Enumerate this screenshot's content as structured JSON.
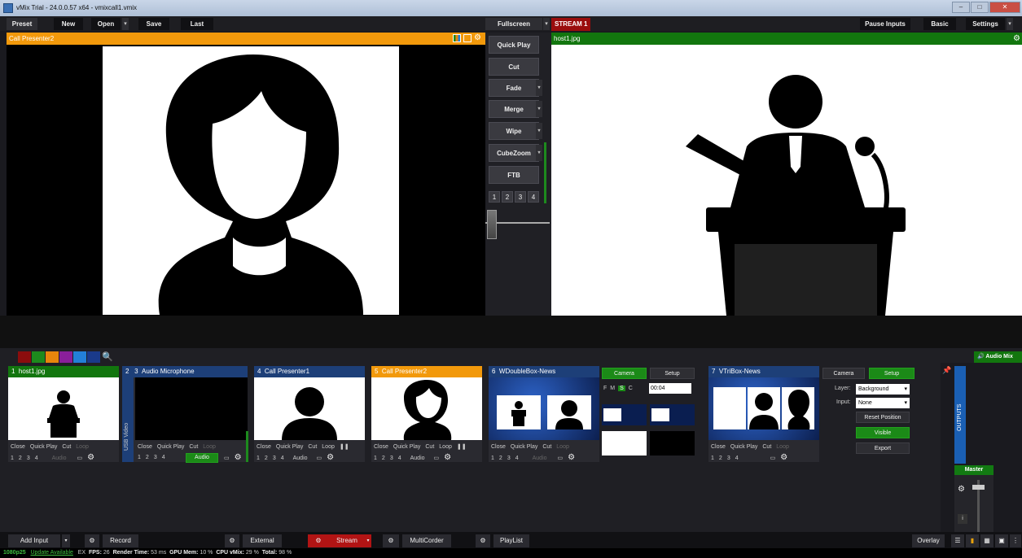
{
  "window": {
    "title": "vMix Trial - 24.0.0.57 x64 - vmixcall1.vmix"
  },
  "topbar": {
    "preset": "Preset",
    "new": "New",
    "open": "Open",
    "save": "Save",
    "last": "Last",
    "fullscreen": "Fullscreen",
    "stream_tab": "STREAM 1",
    "pause_inputs": "Pause Inputs",
    "basic": "Basic",
    "settings": "Settings"
  },
  "preview": {
    "title": "Call Presenter2"
  },
  "program": {
    "title": "host1.jpg"
  },
  "transitions": {
    "quick_play": "Quick Play",
    "cut": "Cut",
    "fade": "Fade",
    "merge": "Merge",
    "wipe": "Wipe",
    "cubezoom": "CubeZoom",
    "ftb": "FTB",
    "nums": [
      "1",
      "2",
      "3",
      "4"
    ]
  },
  "colors": {
    "chips": [
      "#8b0d0d",
      "#1d8a1d",
      "#e8860c",
      "#8a1f9a",
      "#2380d8",
      "#1a3a8a"
    ]
  },
  "inputs": [
    {
      "num": "1",
      "name": "host1.jpg",
      "hdr_color": "#12760e"
    },
    {
      "num": "2",
      "name": "",
      "hdr_color": "#1d3f78"
    },
    {
      "num": "3",
      "name": "Audio Microphone",
      "hdr_color": "#1d3f78"
    },
    {
      "num": "4",
      "name": "Call Presenter1",
      "hdr_color": "#1d3f78"
    },
    {
      "num": "5",
      "name": "Call Presenter2",
      "hdr_color": "#f2990b"
    },
    {
      "num": "6",
      "name": "WDoubleBox-News",
      "hdr_color": "#1d3f78"
    },
    {
      "num": "7",
      "name": "VTriBox-News",
      "hdr_color": "#1d3f78"
    }
  ],
  "input_ctrl": {
    "close": "Close",
    "quick_play": "Quick Play",
    "cut": "Cut",
    "loop": "Loop",
    "audio": "Audio",
    "n1": "1",
    "n2": "2",
    "n3": "3",
    "n4": "4",
    "usb_video": "USB Video"
  },
  "input6": {
    "camera": "Camera",
    "setup": "Setup",
    "f": "F",
    "m": "M",
    "s": "S",
    "c": "C",
    "time": "00:04"
  },
  "input7": {
    "camera": "Camera",
    "setup": "Setup",
    "layer_label": "Layer:",
    "layer_value": "Background",
    "input_label": "Input:",
    "input_value": "None",
    "reset_position": "Reset Position",
    "visible": "Visible",
    "export": "Export"
  },
  "audio": {
    "audio_mixer": "Audio Mix",
    "outputs": "OUTPUTS",
    "master": "Master"
  },
  "bottombar": {
    "add_input": "Add Input",
    "record": "Record",
    "external": "External",
    "stream": "Stream",
    "multicorder": "MultiCorder",
    "playlist": "PlayList",
    "overlay": "Overlay"
  },
  "status": {
    "format": "1080p25",
    "update": "Update Available",
    "ex": "EX",
    "fps_label": "FPS:",
    "fps": "26",
    "render_label": "Render Time:",
    "render": "53 ms",
    "gpu_label": "GPU Mem:",
    "gpu": "10 %",
    "cpu_label": "CPU vMix:",
    "cpu": "29 %",
    "total_label": "Total:",
    "total": "98 %"
  }
}
